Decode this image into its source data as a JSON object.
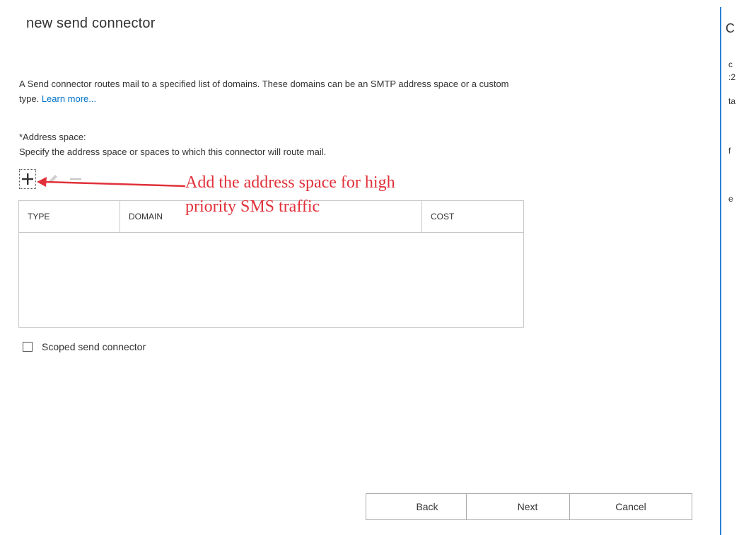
{
  "dialog": {
    "title": "new send connector",
    "intro_text": "A Send connector routes mail to a specified list of domains. These domains can be an SMTP address space or a custom type.",
    "learn_more_label": "Learn more..."
  },
  "address_space": {
    "label": "*Address space:",
    "help_text": "Specify the address space or spaces to which this connector will route mail.",
    "toolbar": {
      "add_icon": "plus-icon",
      "edit_icon": "pencil-icon",
      "remove_icon": "minus-icon"
    },
    "columns": [
      "TYPE",
      "DOMAIN",
      "COST"
    ],
    "rows": []
  },
  "scoped": {
    "label": "Scoped send connector",
    "checked": false
  },
  "buttons": {
    "back": "Back",
    "next": "Next",
    "cancel": "Cancel"
  },
  "annotation": {
    "line1": "Add the address space for high",
    "line2": "priority SMS traffic",
    "color": "#e0313a"
  },
  "background_fragments": [
    "C",
    "c",
    ":2",
    "ta",
    "f",
    "e"
  ],
  "colors": {
    "link": "#0072c6",
    "accent_edge": "#2b7fd4",
    "border": "#c8c8c8"
  }
}
